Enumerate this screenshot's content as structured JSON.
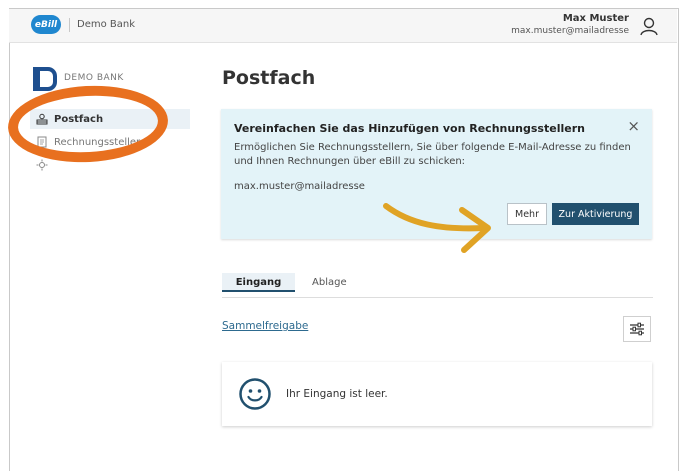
{
  "header": {
    "ebill_logo_text": "eBill",
    "bank_name": "Demo Bank",
    "user_name": "Max Muster",
    "user_email": "max.muster@mailadresse"
  },
  "sidebar": {
    "logo_text": "DEMO BANK",
    "items": [
      {
        "label": "Postfach",
        "icon": "inbox-icon",
        "active": true
      },
      {
        "label": "Rechnungssteller",
        "icon": "document-icon",
        "active": false
      },
      {
        "label": "",
        "icon": "settings-icon",
        "active": false
      }
    ]
  },
  "main": {
    "title": "Postfach",
    "banner": {
      "title": "Vereinfachen Sie das Hinzufügen von Rechnungsstellern",
      "text": "Ermöglichen Sie Rechnungsstellern, Sie über folgende E-Mail-Adresse zu finden und Ihnen Rechnungen über eBill zu schicken:",
      "email": "max.muster@mailadresse",
      "close_label": "×",
      "more_label": "Mehr",
      "activate_label": "Zur Aktivierung"
    },
    "tabs": [
      {
        "label": "Eingang",
        "active": true
      },
      {
        "label": "Ablage",
        "active": false
      }
    ],
    "bulk_link": "Sammelfreigabe",
    "empty_message": "Ihr Eingang ist leer."
  },
  "colors": {
    "accent": "#21506e",
    "brand": "#1f87cf",
    "banner_bg": "#e3f3f8",
    "annotation_orange": "#e8701f",
    "annotation_arrow": "#e0a325"
  }
}
